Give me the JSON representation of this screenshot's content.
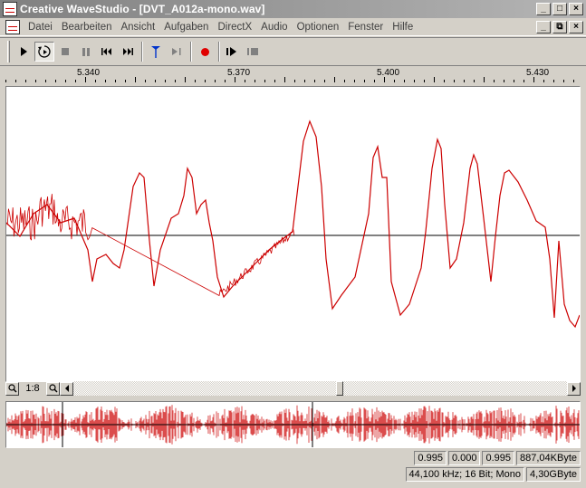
{
  "window": {
    "title": "Creative WaveStudio - [DVT_A012a-mono.wav]",
    "controls": [
      "_",
      "□",
      "×"
    ],
    "mdi_controls": [
      "_",
      "⧉",
      "×"
    ]
  },
  "menu": [
    "Datei",
    "Bearbeiten",
    "Ansicht",
    "Aufgaben",
    "DirectX",
    "Audio",
    "Optionen",
    "Fenster",
    "Hilfe"
  ],
  "toolbar": {
    "buttons": [
      "play",
      "play-loop",
      "stop",
      "pause",
      "skip-back",
      "skip-forward",
      "insert-marker",
      "play-to-end",
      "record",
      "play-selection",
      "stop-selection"
    ]
  },
  "ruler": {
    "labels": [
      "5.340",
      "5.370",
      "5.400",
      "5.430"
    ]
  },
  "waveform": {
    "color": "#cc0000",
    "centerline_color": "#000000"
  },
  "scroll": {
    "zoom_label": "1:8"
  },
  "status": {
    "row1": [
      "0.995",
      "0.000",
      "0.995",
      "887,04KByte"
    ],
    "row2": [
      "44,100 kHz; 16 Bit; Mono",
      "4,30GByte"
    ]
  }
}
